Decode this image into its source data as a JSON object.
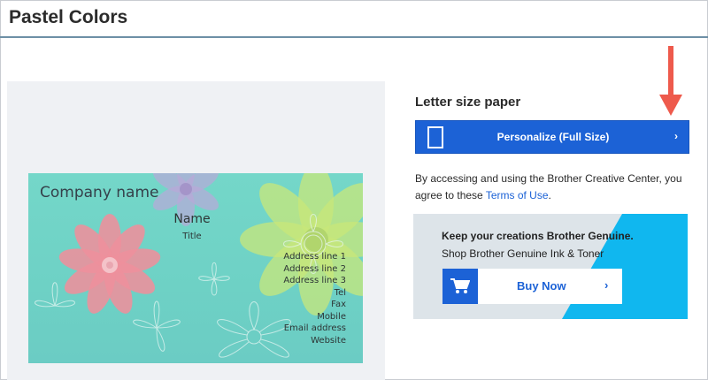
{
  "page": {
    "title": "Pastel Colors"
  },
  "card": {
    "company": "Company name",
    "name": "Name",
    "title": "Title",
    "details": [
      "Address line 1",
      "Address line 2",
      "Address line 3",
      "Tel",
      "Fax",
      "Mobile",
      "Email address",
      "Website"
    ]
  },
  "sidebar": {
    "paper_label": "Letter size paper",
    "personalize_label": "Personalize (Full Size)",
    "personalize_chevron": "›",
    "terms_text": "By accessing and using the Brother Creative Center, you agree to these ",
    "terms_link": "Terms of Use",
    "terms_end": "."
  },
  "promo": {
    "headline": "Keep your creations Brother Genuine.",
    "subline": "Shop Brother Genuine Ink & Toner",
    "buy_label": "Buy Now",
    "buy_chevron": "›"
  },
  "colors": {
    "accent": "#1c62d6",
    "arrow": "#ee5a4c",
    "promo_blue": "#10b7ef",
    "card_teal": "#70d3c7"
  },
  "icons": {
    "arrow": "red-down-arrow-icon",
    "page": "page-outline-icon",
    "cart": "shopping-cart-icon"
  }
}
